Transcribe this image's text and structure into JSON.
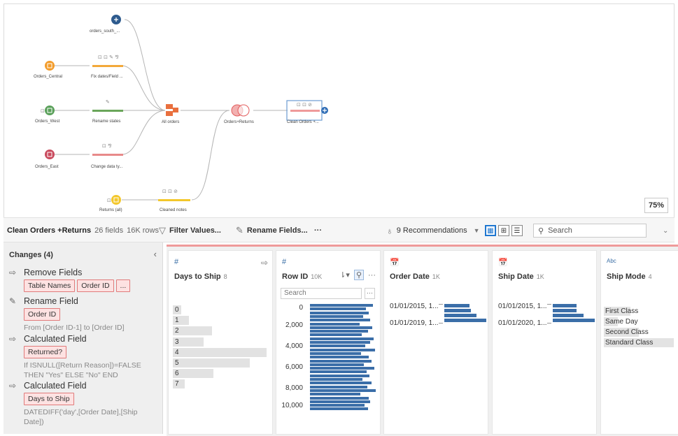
{
  "canvas": {
    "zoom": "75%",
    "nodes": [
      {
        "id": "orders_south",
        "label": "orders_south_...",
        "kind": "input",
        "color": "#2e5b8e"
      },
      {
        "id": "orders_central",
        "label": "Orders_Central",
        "kind": "input",
        "color": "#f39c2b"
      },
      {
        "id": "fix_dates",
        "label": "Fix dates/Field ...",
        "kind": "clean",
        "color": "#f3a93a"
      },
      {
        "id": "orders_west",
        "label": "Orders_West",
        "kind": "input",
        "color": "#5aa05a"
      },
      {
        "id": "rename_states",
        "label": "Rename states",
        "kind": "clean",
        "color": "#6aa65a"
      },
      {
        "id": "all_orders",
        "label": "All orders",
        "kind": "union",
        "color": "#e9703e"
      },
      {
        "id": "orders_returns",
        "label": "Orders+Returns",
        "kind": "join",
        "color": "#e35d5d"
      },
      {
        "id": "clean_orders",
        "label": "Clean Orders +...",
        "kind": "clean",
        "color": "#ef9a9a"
      },
      {
        "id": "orders_east",
        "label": "Orders_East",
        "kind": "input",
        "color": "#c94b5e"
      },
      {
        "id": "change_data_ty",
        "label": "Change data ty...",
        "kind": "clean",
        "color": "#e88a8a"
      },
      {
        "id": "returns_all",
        "label": "Returns (all)",
        "kind": "input",
        "color": "#f3c72b"
      },
      {
        "id": "cleaned_notes",
        "label": "Cleaned notes",
        "kind": "clean",
        "color": "#f3c72b"
      }
    ]
  },
  "toolbar": {
    "title": "Clean Orders +Returns",
    "fields": "26 fields",
    "rows": "16K rows",
    "filter": "Filter Values...",
    "rename": "Rename Fields...",
    "more": "···",
    "recommendations": "9 Recommendations",
    "search_placeholder": "Search"
  },
  "changes": {
    "title": "Changes (4)",
    "items": [
      {
        "type": "Remove Fields",
        "pills": [
          "Table Names",
          "Order ID",
          "..."
        ]
      },
      {
        "type": "Rename Field",
        "pills": [
          "Order ID"
        ],
        "detail": "From [Order ID-1] to [Order ID]"
      },
      {
        "type": "Calculated Field",
        "pills": [
          "Returned?"
        ],
        "detail1": "If ISNULL([Return Reason])=FALSE",
        "detail2": "THEN \"Yes\" ELSE \"No\" END"
      },
      {
        "type": "Calculated Field",
        "pills": [
          "Days to Ship"
        ],
        "detail1": "DATEDIFF('day',[Order Date],[Ship",
        "detail2": "Date])"
      }
    ]
  },
  "profile": {
    "cards": [
      {
        "type": "#",
        "name": "Days to Ship",
        "count": "8",
        "bins": [
          {
            "label": "0",
            "value": 0.09
          },
          {
            "label": "1",
            "value": 0.17
          },
          {
            "label": "2",
            "value": 0.42
          },
          {
            "label": "3",
            "value": 0.33
          },
          {
            "label": "4",
            "value": 1.0
          },
          {
            "label": "5",
            "value": 0.82
          },
          {
            "label": "6",
            "value": 0.43
          },
          {
            "label": "7",
            "value": 0.13
          }
        ]
      },
      {
        "type": "#",
        "name": "Row ID",
        "count": "10K",
        "search_placeholder": "Search",
        "ticks": [
          "0",
          "2,000",
          "4,000",
          "6,000",
          "8,000",
          "10,000"
        ]
      },
      {
        "type": "date",
        "name": "Order Date",
        "count": "1K",
        "labels": [
          "01/01/2015, 1...",
          "01/01/2019, 1..."
        ]
      },
      {
        "type": "date",
        "name": "Ship Date",
        "count": "1K",
        "labels": [
          "01/01/2015, 1...",
          "01/01/2020, 1..."
        ]
      },
      {
        "type": "Abc",
        "name": "Ship Mode",
        "count": "4",
        "values": [
          {
            "label": "First Class",
            "value": 0.38
          },
          {
            "label": "Same Day",
            "value": 0.2
          },
          {
            "label": "Second Class",
            "value": 0.5
          },
          {
            "label": "Standard Class",
            "value": 1.0
          }
        ]
      }
    ]
  },
  "colors": {
    "accent": "#1f77d0",
    "bar": "#3b6ea8",
    "selected_red": "#ef9a9a"
  }
}
